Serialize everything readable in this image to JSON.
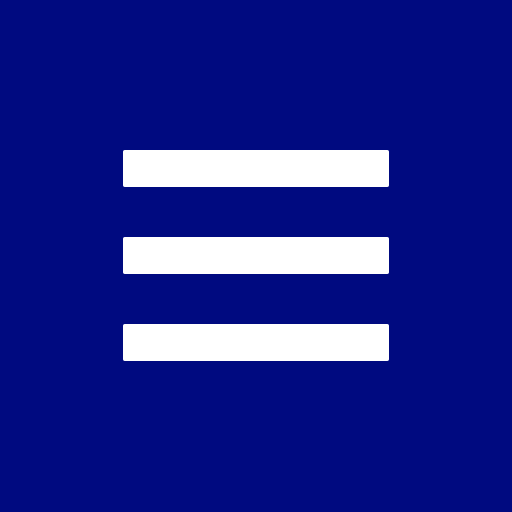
{
  "icon": "hamburger-menu-icon",
  "colors": {
    "background": "#000a80",
    "icon": "#ffffff"
  }
}
